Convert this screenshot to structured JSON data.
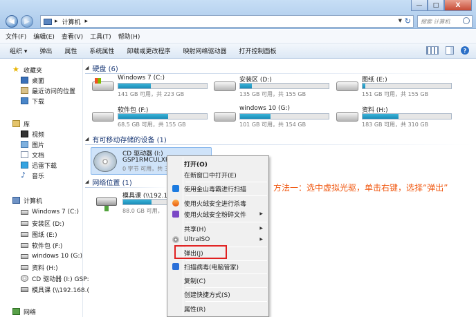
{
  "window": {
    "minimize": "—",
    "maximize": "□",
    "close": "X"
  },
  "address": {
    "breadcrumb": [
      "▸",
      "计算机",
      "▸"
    ],
    "search_placeholder": "搜索 计算机"
  },
  "menubar": [
    "文件(F)",
    "编辑(E)",
    "查看(V)",
    "工具(T)",
    "帮助(H)"
  ],
  "commandbar": [
    "组织 ▾",
    "弹出",
    "属性",
    "系统属性",
    "卸载或更改程序",
    "映射网络驱动器",
    "打开控制面板"
  ],
  "sidebar": {
    "favorites": [
      "收藏夹",
      "桌面",
      "最近访问的位置",
      "下载"
    ],
    "libraries": [
      "库",
      "视频",
      "图片",
      "文档",
      "迅雷下载",
      "音乐"
    ],
    "computer": [
      "计算机",
      "Windows 7 (C:)",
      "安装区 (D:)",
      "图纸 (E:)",
      "软件包 (F:)",
      "windows 10 (G:)",
      "资料 (H:)",
      "CD 驱动器 (I:) GSP:",
      "模具课 (\\\\192.168.("
    ],
    "network": "网络"
  },
  "groups": {
    "hdd": "硬盘 (6)",
    "removable": "有可移动存储的设备 (1)",
    "network": "网络位置 (1)"
  },
  "drives": [
    {
      "name": "Windows 7 (C:)",
      "size": "141 GB 可用，共 223 GB",
      "used_fraction": 0.37
    },
    {
      "name": "安装区 (D:)",
      "size": "135 GB 可用，共 155 GB",
      "used_fraction": 0.13
    },
    {
      "name": "图纸 (E:)",
      "size": "151 GB 可用，共 155 GB",
      "used_fraction": 0.03
    },
    {
      "name": "软件包 (F:)",
      "size": "68.5 GB 可用，共 155 GB",
      "used_fraction": 0.56
    },
    {
      "name": "windows 10 (G:)",
      "size": "101 GB 可用，共 154 GB",
      "used_fraction": 0.34
    },
    {
      "name": "资料 (H:)",
      "size": "183 GB 可用，共 310 GB",
      "used_fraction": 0.41
    }
  ],
  "cd": {
    "line1": "CD 驱动器 (I:)",
    "line2": "GSP1RMCULXFRE",
    "line3": "0 字节 可用，共 3."
  },
  "netloc": {
    "name": "模具课 (\\\\192.168.",
    "size": "88.0 GB 可用，",
    "used_fraction": 0.6
  },
  "annotation": "方法一：选中虚拟光驱，单击右键，选择“弹出”",
  "context_menu": {
    "open": "打开(O)",
    "open_new": "在新窗口中打开(E)",
    "jinshan": "使用金山毒霸进行扫描",
    "hx_kill": "使用火绒安全进行杀毒",
    "hx_shred": "使用火绒安全粉碎文件",
    "share": "共享(H)",
    "ultraiso": "UltraISO",
    "eject": "弹出(J)",
    "scan": "扫描病毒(电脑管家)",
    "copy": "复制(C)",
    "shortcut": "创建快捷方式(S)",
    "props": "属性(R)"
  }
}
